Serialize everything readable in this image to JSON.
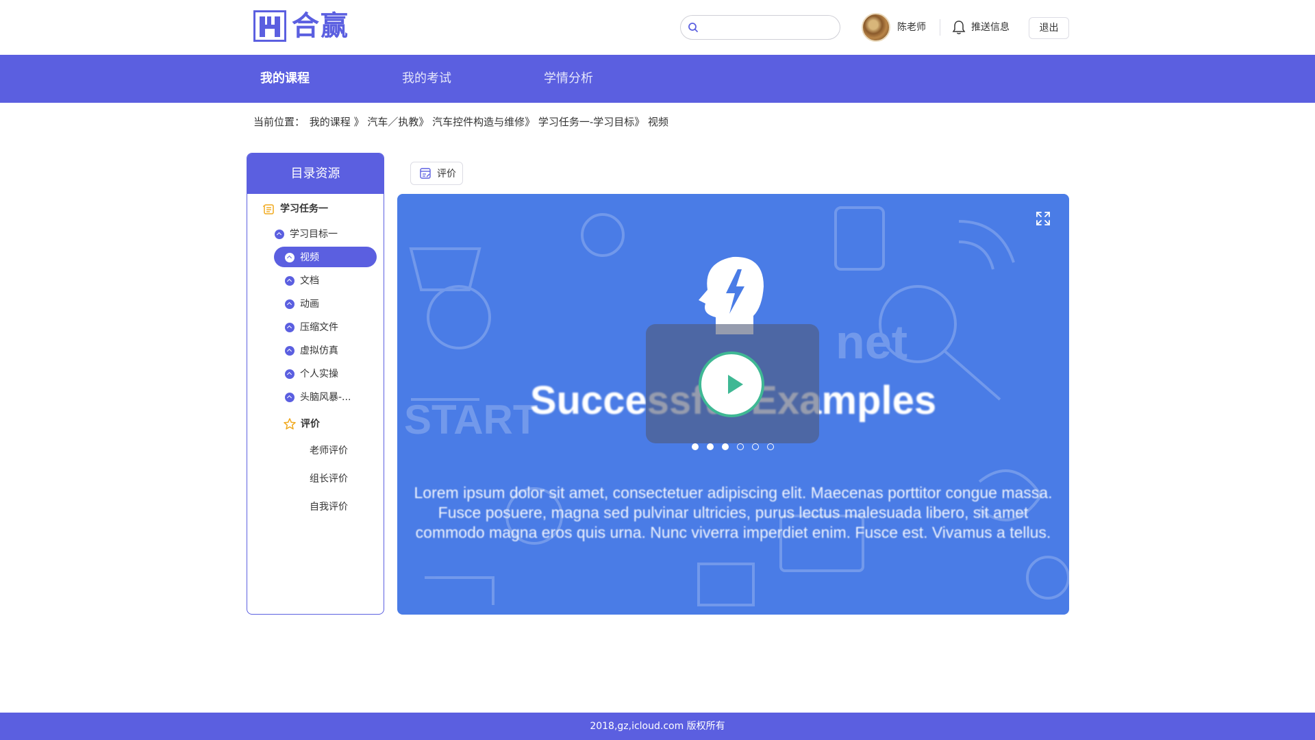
{
  "header": {
    "logo_text": "合赢",
    "search_placeholder": "",
    "username": "陈老师",
    "push_label": "推送信息",
    "logout_label": "退出"
  },
  "nav": {
    "items": [
      {
        "label": "我的课程",
        "active": true
      },
      {
        "label": "我的考试",
        "active": false
      },
      {
        "label": "学情分析",
        "active": false
      }
    ]
  },
  "breadcrumb": {
    "prefix": "当前位置：",
    "path": "我的课程 》 汽车／执教》 汽车控件构造与维修》 学习任务一-学习目标》 视频"
  },
  "sidebar": {
    "title": "目录资源",
    "task": "学习任务一",
    "goal": "学习目标一",
    "resources": [
      "视频",
      "文档",
      "动画",
      "压缩文件",
      "虚拟仿真",
      "个人实操",
      "头脑风暴-..."
    ],
    "evaluate": "评价",
    "evaluations": [
      "老师评价",
      "组长评价",
      "自我评价"
    ]
  },
  "toolbar": {
    "evaluate_tab": "评价"
  },
  "player": {
    "slide_title": "Successful Examples",
    "slide_text": "Lorem ipsum dolor sit amet, consectetuer adipiscing elit. Maecenas porttitor congue massa. Fusce posuere, magna sed pulvinar ultricies, purus lectus malesuada libero, sit amet commodo magna eros quis urna. Nunc viverra imperdiet enim. Fusce est. Vivamus a tellus.",
    "slide_count": 6,
    "current_slide": 3
  },
  "footer": {
    "text": "2018,gz,icloud.com 版权所有"
  },
  "colors": {
    "accent": "#5b5fe0",
    "player_bg": "#4a7ce6",
    "play_green": "#3fb894"
  }
}
